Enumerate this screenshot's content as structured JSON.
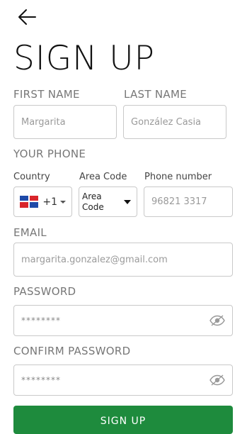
{
  "header": {
    "title": "SIGN UP",
    "back_icon": "arrow-left-icon"
  },
  "form": {
    "first_name": {
      "label": "FIRST NAME",
      "value": "Margarita"
    },
    "last_name": {
      "label": "LAST NAME",
      "value": "González Casia"
    },
    "phone": {
      "section_label": "YOUR PHONE",
      "country_label": "Country",
      "country_code": "+1",
      "country_flag": "dominican-republic-flag-icon",
      "area_label": "Area Code",
      "area_value": "Area Code",
      "number_label": "Phone number",
      "number_value": "96821 3317"
    },
    "email": {
      "label": "EMAIL",
      "value": "margarita.gonzalez@gmail.com"
    },
    "password": {
      "label": "PASSWORD",
      "value": "********",
      "toggle_icon": "eye-off-icon"
    },
    "confirm_password": {
      "label": "CONFIRM PASSWORD",
      "value": "********",
      "toggle_icon": "eye-off-icon"
    },
    "submit_label": "SIGN UP"
  },
  "colors": {
    "accent": "#1e8b3d",
    "label": "#777777",
    "border": "#c9c9c9"
  }
}
